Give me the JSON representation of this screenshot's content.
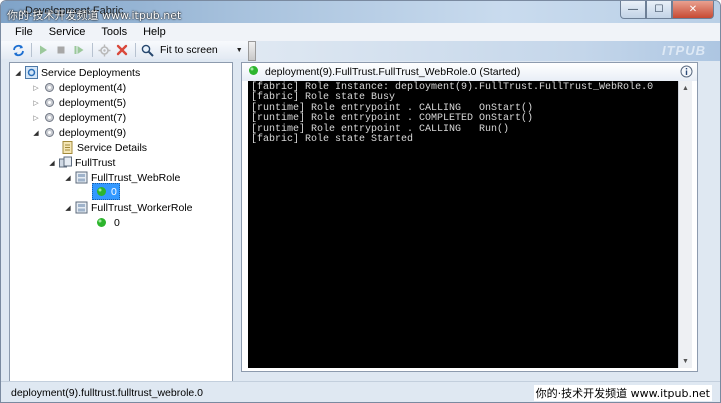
{
  "window": {
    "title": "Development Fabric",
    "watermark_top": "你的·技术开发频道 www.itpub.net",
    "controls": {
      "minimize": "—",
      "maximize": "☐",
      "close": "✕"
    }
  },
  "menu": [
    {
      "label": "File"
    },
    {
      "label": "Service"
    },
    {
      "label": "Tools"
    },
    {
      "label": "Help"
    }
  ],
  "toolbar": {
    "fit_label": "Fit to screen",
    "icons": [
      "refresh-icon",
      "run-icon",
      "stop-icon",
      "restart-icon",
      "attach-icon",
      "delete-icon",
      "zoom-icon"
    ],
    "brand_ghost": "ITPUB"
  },
  "tree": {
    "root": "Service Deployments",
    "deployments": [
      {
        "label": "deployment(4)"
      },
      {
        "label": "deployment(5)"
      },
      {
        "label": "deployment(7)"
      },
      {
        "label": "deployment(9)"
      }
    ],
    "service_details": "Service Details",
    "fulltrust": "FullTrust",
    "web_role": "FullTrust_WebRole",
    "web_instance": "0",
    "worker_role": "FullTrust_WorkerRole",
    "worker_instance": "0"
  },
  "console": {
    "header": "deployment(9).FullTrust.FullTrust_WebRole.0 (Started)",
    "lines": [
      "[fabric] Role Instance: deployment(9).FullTrust.FullTrust_WebRole.0",
      "[fabric] Role state Busy",
      "[runtime] Role entrypoint . CALLING   OnStart()",
      "[runtime] Role entrypoint . COMPLETED OnStart()",
      "[runtime] Role entrypoint . CALLING   Run()",
      "[fabric] Role state Started"
    ]
  },
  "statusbar": {
    "text": "deployment(9).fulltrust.fulltrust_webrole.0",
    "watermark": "你的·技术开发频道 www.itpub.net"
  },
  "colors": {
    "status_green": "#2db52d",
    "selection": "#3399ff",
    "console_bg": "#000000",
    "console_fg": "#d9d9d9"
  }
}
